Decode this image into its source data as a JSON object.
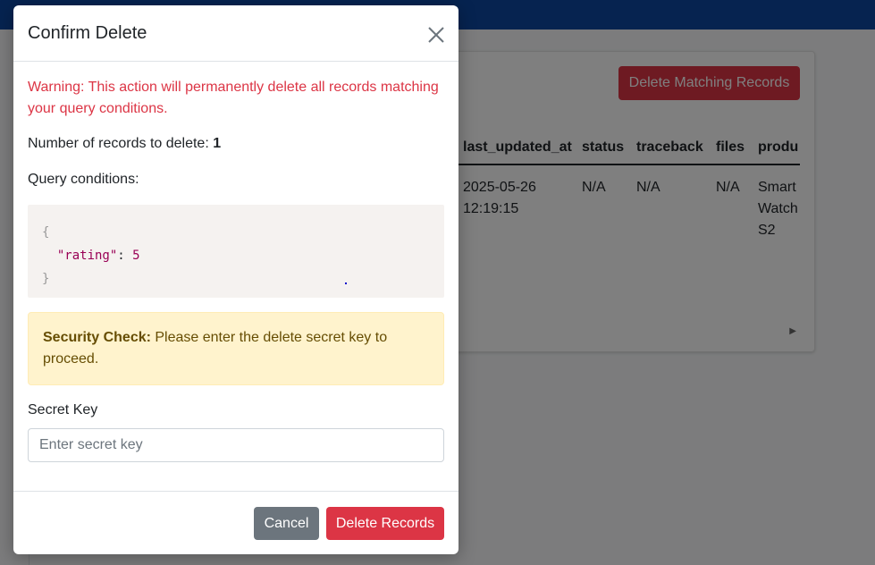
{
  "background": {
    "delete_matching_label": "Delete Matching Records",
    "table": {
      "columns": [
        "last_updated_at",
        "status",
        "traceback",
        "files",
        "produ"
      ],
      "row": [
        "2025-05-26\n12:19:15",
        "N/A",
        "N/A",
        "N/A",
        "Smart\nWatch\nS2"
      ]
    }
  },
  "modal": {
    "title": "Confirm Delete",
    "close_icon": "close-icon",
    "warning": "Warning: This action will permanently delete all records matching your query conditions.",
    "count_label": "Number of records to delete: ",
    "count_value": "1",
    "query_label": "Query conditions:",
    "query": {
      "open_brace": "{",
      "key": "\"rating\"",
      "colon": ": ",
      "value": "5",
      "close_brace": "}"
    },
    "security_title": "Security Check:",
    "security_text": " Please enter the delete secret key to proceed.",
    "secret_label": "Secret Key",
    "secret_placeholder": "Enter secret key",
    "secret_value": "",
    "cancel_label": "Cancel",
    "delete_label": "Delete Records"
  },
  "colors": {
    "danger": "#dc3545",
    "secondary": "#6c757d",
    "topbar": "#0d47a1",
    "warning_bg": "#fff3cd"
  }
}
